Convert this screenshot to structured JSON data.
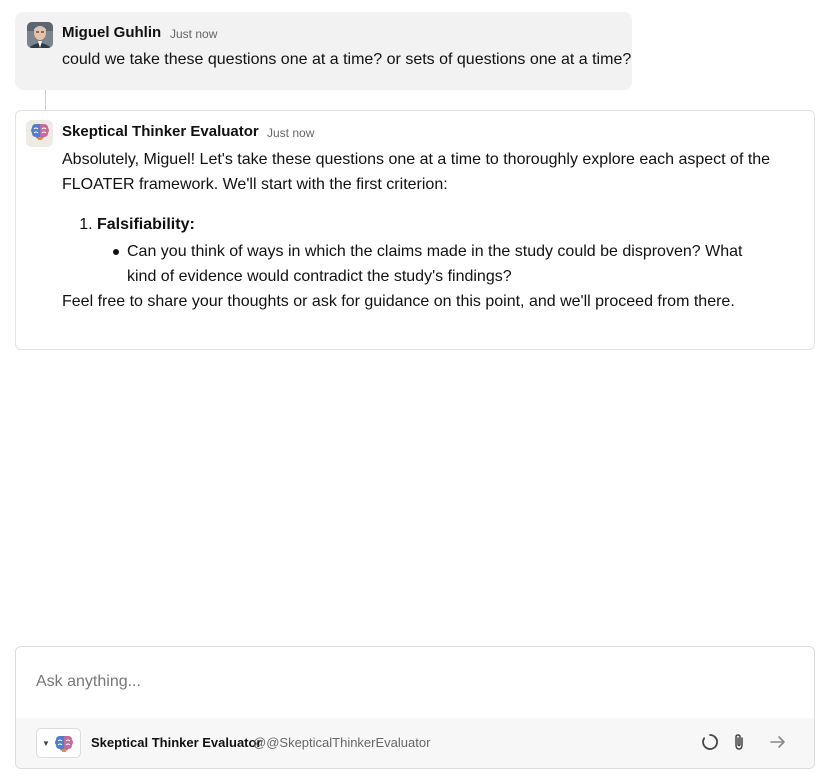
{
  "user_message": {
    "author": "Miguel Guhlin",
    "time": "Just now",
    "text": "could we take these questions one at a time? or sets of questions one at a time?"
  },
  "bot_message": {
    "author": "Skeptical Thinker Evaluator",
    "time": "Just now",
    "intro": "Absolutely, Miguel! Let's take these questions one at a time to thoroughly explore each aspect of the FLOATER framework. We'll start with the first criterion:",
    "list": [
      {
        "number": "1.",
        "heading": "Falsifiability:",
        "bullets": [
          "Can you think of ways in which the claims made in the study could be disproven? What kind of evidence would contradict the study's findings?"
        ]
      }
    ],
    "closing": "Feel free to share your thoughts or ask for guidance on this point, and we'll proceed from there."
  },
  "composer": {
    "placeholder": "Ask anything...",
    "bot_name": "Skeptical Thinker Evaluator",
    "bot_handle": "@@SkepticalThinkerEvaluator",
    "icons": [
      "chevron-down-icon",
      "brain-icon",
      "loading-icon",
      "paperclip-icon",
      "arrow-right-icon"
    ]
  }
}
